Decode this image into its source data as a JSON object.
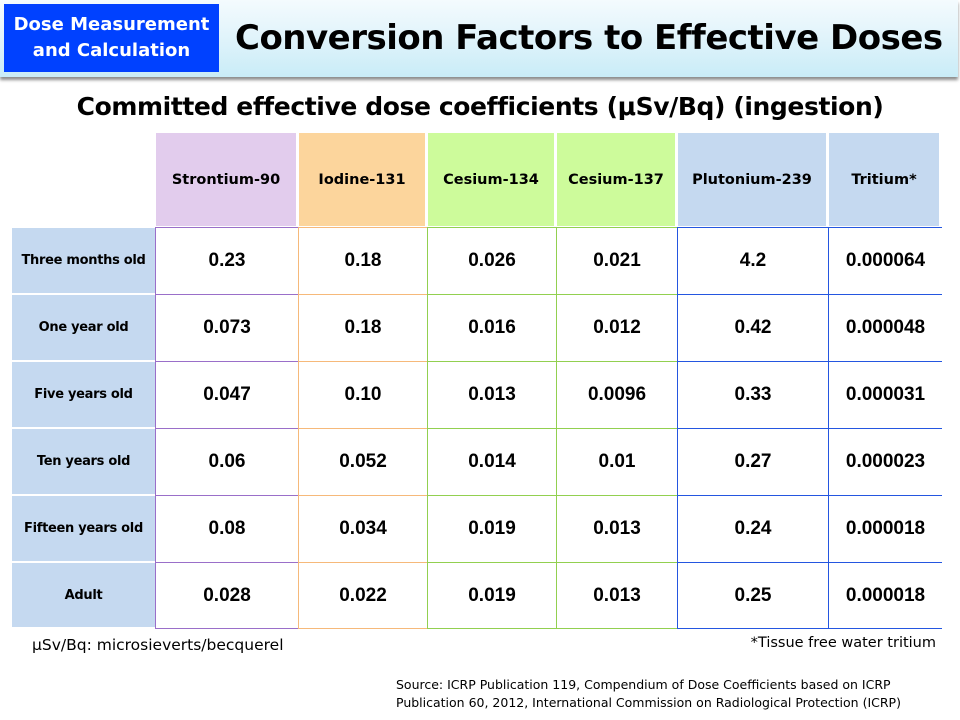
{
  "header": {
    "badge_line1": "Dose Measurement",
    "badge_line2": "and Calculation",
    "title": "Conversion Factors to Effective Doses",
    "badge_color": "#0041ff"
  },
  "subtitle": "Committed effective dose coefficients (μSv/Bq) (ingestion)",
  "table": {
    "columns": [
      {
        "label": "Strontium-90",
        "header_color": "#e2cced",
        "line_color": "#9a6fc9"
      },
      {
        "label": "Iodine-131",
        "header_color": "#fcd59c",
        "line_color": "#f6b97a"
      },
      {
        "label": "Cesium-134",
        "header_color": "#cdfb9b",
        "line_color": "#92d050"
      },
      {
        "label": "Cesium-137",
        "header_color": "#cdfb9b",
        "line_color": "#92d050"
      },
      {
        "label": "Plutonium-239",
        "header_color": "#c5d9f0",
        "line_color": "#2456e0"
      },
      {
        "label": "Tritium*",
        "header_color": "#c5d9f0",
        "line_color": "#2456e0"
      }
    ],
    "rows": [
      {
        "label": "Three months old",
        "values": [
          "0.23",
          "0.18",
          "0.026",
          "0.021",
          "4.2",
          "0.000064"
        ]
      },
      {
        "label": "One year old",
        "values": [
          "0.073",
          "0.18",
          "0.016",
          "0.012",
          "0.42",
          "0.000048"
        ]
      },
      {
        "label": "Five years old",
        "values": [
          "0.047",
          "0.10",
          "0.013",
          "0.0096",
          "0.33",
          "0.000031"
        ]
      },
      {
        "label": "Ten years old",
        "values": [
          "0.06",
          "0.052",
          "0.014",
          "0.01",
          "0.27",
          "0.000023"
        ]
      },
      {
        "label": "Fifteen years old",
        "values": [
          "0.08",
          "0.034",
          "0.019",
          "0.013",
          "0.24",
          "0.000018"
        ]
      },
      {
        "label": "Adult",
        "values": [
          "0.028",
          "0.022",
          "0.019",
          "0.013",
          "0.25",
          "0.000018"
        ]
      }
    ]
  },
  "notes": {
    "unit_note": "μSv/Bq: microsieverts/becquerel",
    "tritium_note": "*Tissue free water tritium",
    "source_line1": "Source: ICRP Publication 119, Compendium of Dose Coefficients based on ICRP",
    "source_line2": "Publication 60, 2012, International Commission on Radiological Protection (ICRP)"
  }
}
